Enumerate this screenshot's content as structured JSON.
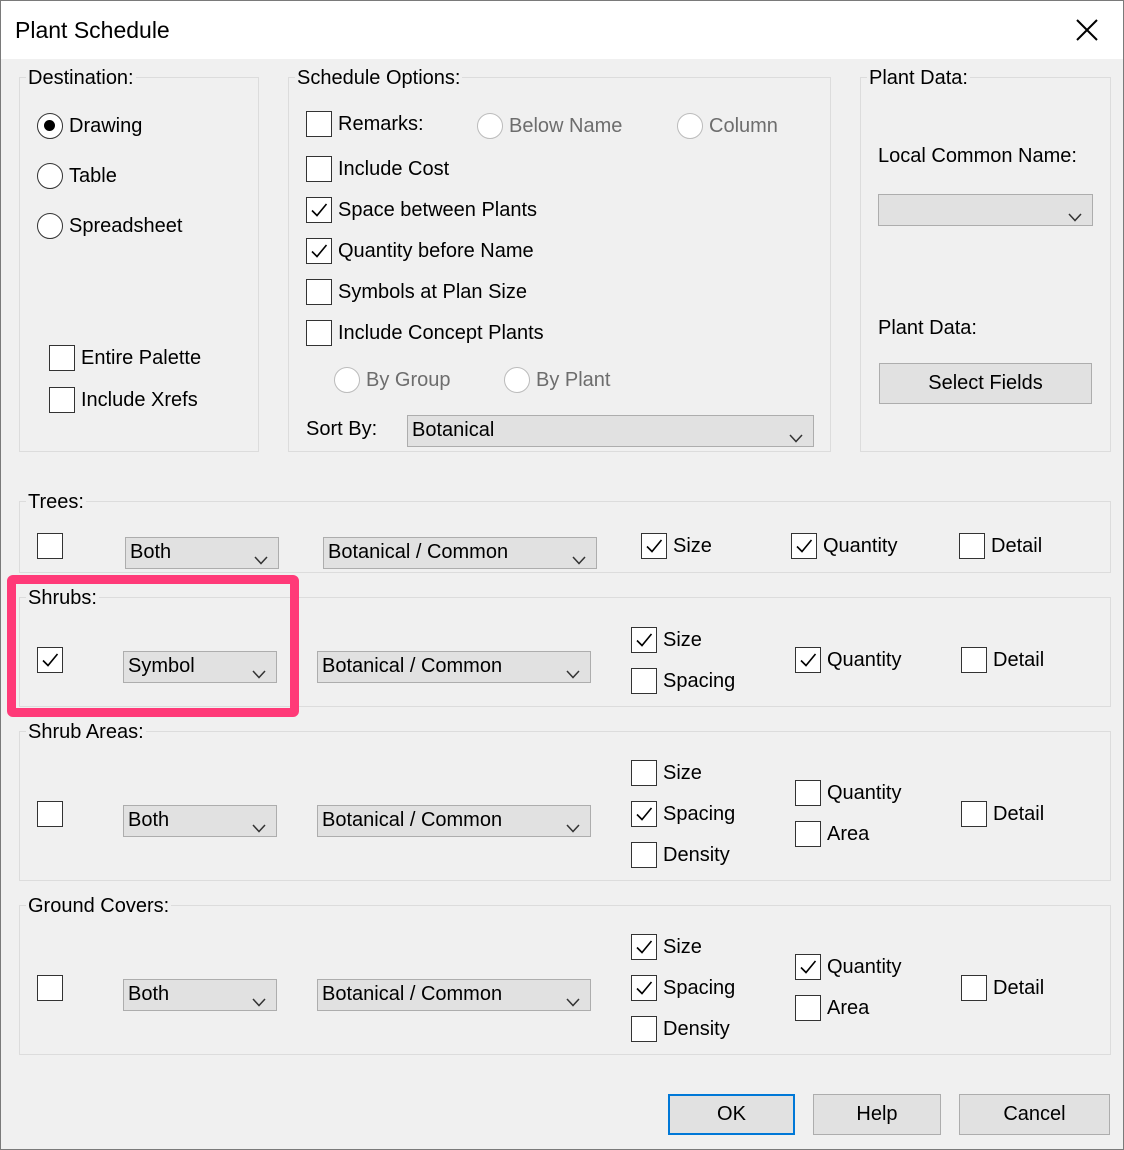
{
  "window": {
    "title": "Plant Schedule"
  },
  "destination": {
    "label": "Destination:",
    "options": [
      {
        "label": "Drawing",
        "selected": true
      },
      {
        "label": "Table",
        "selected": false
      },
      {
        "label": "Spreadsheet",
        "selected": false
      }
    ],
    "entire_palette": {
      "label": "Entire Palette",
      "checked": false
    },
    "include_xrefs": {
      "label": "Include Xrefs",
      "checked": false
    }
  },
  "schedule_options": {
    "label": "Schedule Options:",
    "remarks": {
      "label": "Remarks:",
      "checked": false
    },
    "remarks_below_name": "Below Name",
    "remarks_column": "Column",
    "include_cost": {
      "label": "Include Cost",
      "checked": false
    },
    "space_between_plants": {
      "label": "Space between Plants",
      "checked": true
    },
    "quantity_before_name": {
      "label": "Quantity before Name",
      "checked": true
    },
    "symbols_at_plan_size": {
      "label": "Symbols at Plan Size",
      "checked": false
    },
    "include_concept_plants": {
      "label": "Include Concept Plants",
      "checked": false
    },
    "by_group": "By Group",
    "by_plant": "By Plant",
    "sort_by_label": "Sort By:",
    "sort_by_value": "Botanical"
  },
  "plant_data": {
    "label": "Plant Data:",
    "local_common_name_label": "Local Common Name:",
    "local_common_name_value": "",
    "plant_data_label": "Plant Data:",
    "select_fields": "Select Fields"
  },
  "trees": {
    "label": "Trees:",
    "enabled": false,
    "display": "Both",
    "naming": "Botanical / Common",
    "size": {
      "label": "Size",
      "checked": true
    },
    "quantity": {
      "label": "Quantity",
      "checked": true
    },
    "detail": {
      "label": "Detail",
      "checked": false
    }
  },
  "shrubs": {
    "label": "Shrubs:",
    "enabled": true,
    "display": "Symbol",
    "naming": "Botanical / Common",
    "size": {
      "label": "Size",
      "checked": true
    },
    "spacing": {
      "label": "Spacing",
      "checked": false
    },
    "quantity": {
      "label": "Quantity",
      "checked": true
    },
    "detail": {
      "label": "Detail",
      "checked": false
    }
  },
  "shrub_areas": {
    "label": "Shrub Areas:",
    "enabled": false,
    "display": "Both",
    "naming": "Botanical / Common",
    "size": {
      "label": "Size",
      "checked": false
    },
    "spacing": {
      "label": "Spacing",
      "checked": true
    },
    "density": {
      "label": "Density",
      "checked": false
    },
    "quantity": {
      "label": "Quantity",
      "checked": false
    },
    "area": {
      "label": "Area",
      "checked": false
    },
    "detail": {
      "label": "Detail",
      "checked": false
    }
  },
  "ground_covers": {
    "label": "Ground Covers:",
    "enabled": false,
    "display": "Both",
    "naming": "Botanical / Common",
    "size": {
      "label": "Size",
      "checked": true
    },
    "spacing": {
      "label": "Spacing",
      "checked": true
    },
    "density": {
      "label": "Density",
      "checked": false
    },
    "quantity": {
      "label": "Quantity",
      "checked": true
    },
    "area": {
      "label": "Area",
      "checked": false
    },
    "detail": {
      "label": "Detail",
      "checked": false
    }
  },
  "buttons": {
    "ok": "OK",
    "help": "Help",
    "cancel": "Cancel"
  },
  "colors": {
    "highlight": "#ff3a78",
    "default_button_border": "#0078d7",
    "dialog_bg": "#f0f0f0"
  },
  "icons": {
    "close": "close-icon",
    "dropdown": "chevron-down-icon",
    "check": "checkmark-icon"
  }
}
